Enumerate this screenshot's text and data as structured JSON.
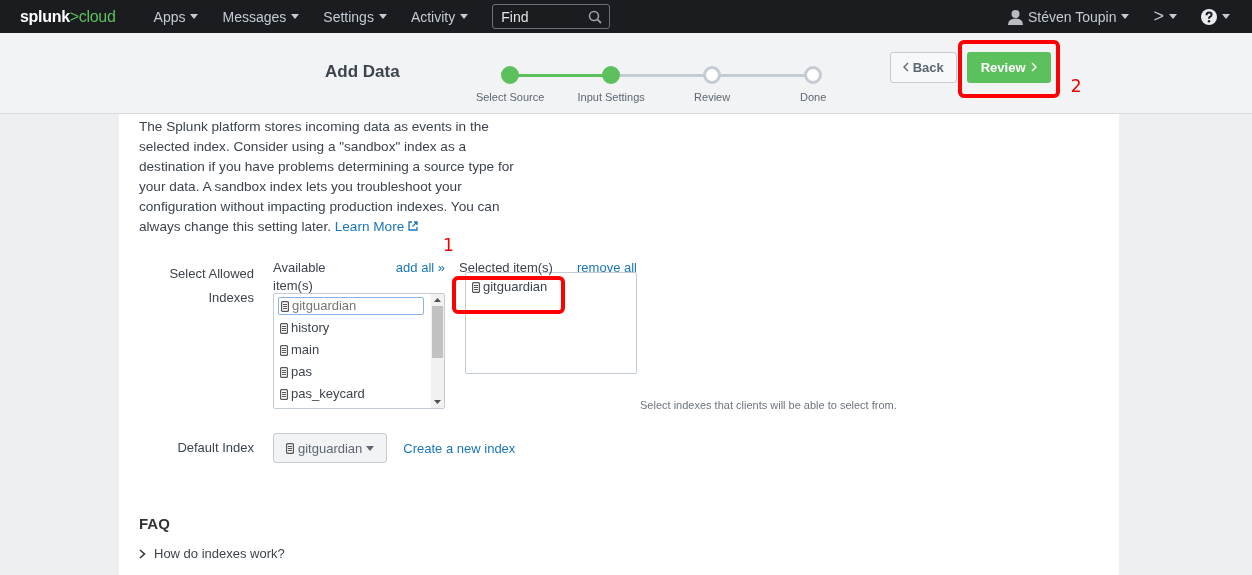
{
  "navbar": {
    "logo_main": "splunk",
    "logo_mark": ">",
    "logo_accent": "cloud",
    "menus": [
      "Apps",
      "Messages",
      "Settings",
      "Activity"
    ],
    "search": {
      "placeholder": "Find"
    },
    "user": "Stéven Toupin",
    "prompt": ">"
  },
  "header": {
    "title": "Add Data",
    "steps": [
      {
        "label": "Select Source",
        "done": true
      },
      {
        "label": "Input Settings",
        "done": true
      },
      {
        "label": "Review",
        "done": false
      },
      {
        "label": "Done",
        "done": false
      }
    ],
    "back_button": "Back",
    "next_button": "Review"
  },
  "intro": {
    "text": "The Splunk platform stores incoming data as events in the selected index. Consider using a \"sandbox\" index as a destination if you have problems determining a source type for your data. A sandbox index lets you troubleshoot your configuration without impacting production indexes. You can always change this setting later.",
    "link": "Learn More"
  },
  "allowed_indexes": {
    "label": "Select Allowed Indexes",
    "available_label": "Available item(s)",
    "add_all": "add all »",
    "selected_label": "Selected item(s)",
    "remove_all": "remove all",
    "available": [
      {
        "name": "gitguardian",
        "selected": true
      },
      {
        "name": "history",
        "selected": false
      },
      {
        "name": "main",
        "selected": false
      },
      {
        "name": "pas",
        "selected": false
      },
      {
        "name": "pas_keycard",
        "selected": false
      }
    ],
    "chosen": [
      "gitguardian"
    ],
    "help": "Select indexes that clients will be able to select from."
  },
  "default_index": {
    "label": "Default Index",
    "value": "gitguardian",
    "link": "Create a new index"
  },
  "faq": {
    "title": "FAQ",
    "items": [
      {
        "question": "How do indexes work?",
        "expanded": false
      }
    ]
  },
  "annotations": [
    {
      "label": "1"
    },
    {
      "label": "2"
    }
  ]
}
